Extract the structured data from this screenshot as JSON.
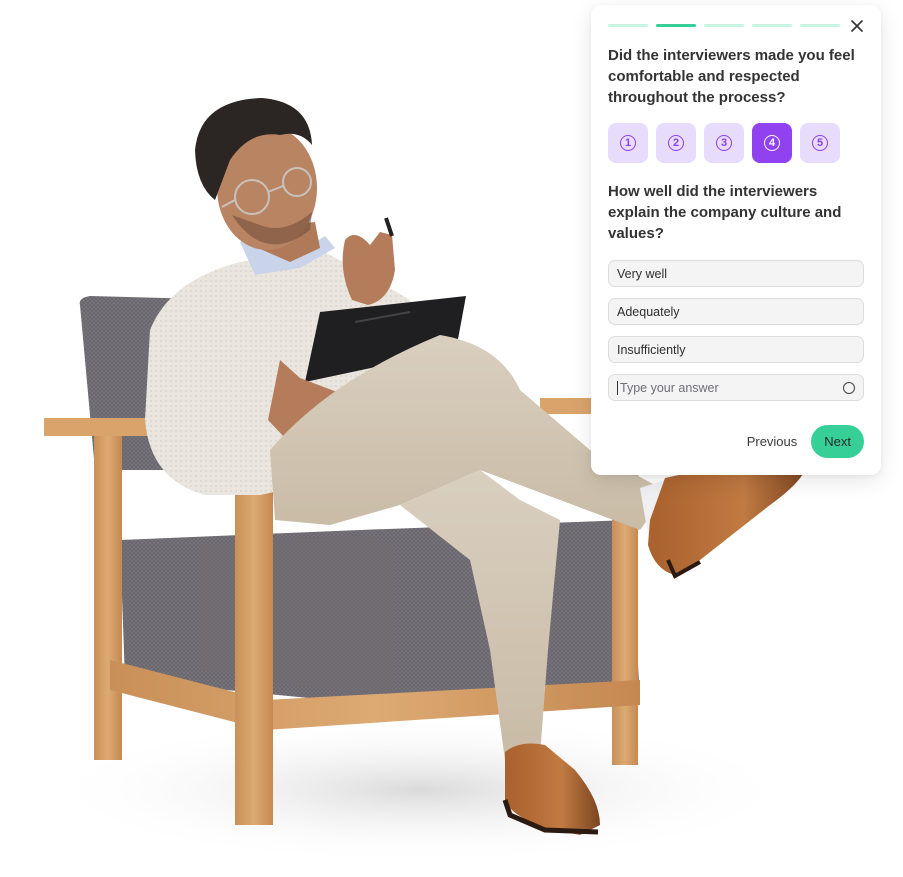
{
  "colors": {
    "accent_green": "#35cf97",
    "progress_inactive": "#c9f3e2",
    "rating_bg": "#e8dcfc",
    "rating_selected": "#9142f0",
    "rating_stroke": "#8b3ff0",
    "text_dark": "#333333"
  },
  "survey": {
    "progress": {
      "total_steps": 5,
      "current_step": 2
    },
    "close_icon": "close-icon",
    "question1": {
      "text": "Did the interviewers made you feel comfortable and respected throughout the process?",
      "ratings": [
        {
          "label": "1",
          "selected": false
        },
        {
          "label": "2",
          "selected": false
        },
        {
          "label": "3",
          "selected": false
        },
        {
          "label": "4",
          "selected": true
        },
        {
          "label": "5",
          "selected": false
        }
      ]
    },
    "question2": {
      "text": "How well did the interviewers explain the company culture and values?",
      "options": [
        "Very well",
        "Adequately",
        "Insufficiently"
      ],
      "custom_answer": {
        "value": "",
        "placeholder": "Type your answer"
      }
    },
    "buttons": {
      "previous": "Previous",
      "next": "Next"
    }
  },
  "illustration": {
    "description": "Man with glasses in cream sweater and khaki pants sitting cross-legged on a grey upholstered wooden armchair, holding a clipboard"
  }
}
